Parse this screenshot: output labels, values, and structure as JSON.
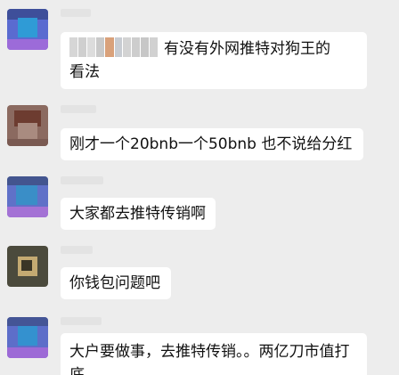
{
  "messages": [
    {
      "mention_masked": true,
      "line1": "有没有外网推特对狗王的",
      "line2": "看法"
    },
    {
      "text": "刚才一个20bnb一个50bnb 也不说给分红"
    },
    {
      "text": "大家都去推特传销啊"
    },
    {
      "text": "你钱包问题吧"
    },
    {
      "line1": "大户要做事，去推特传销。。两亿刀市值打",
      "line2": "底"
    }
  ]
}
